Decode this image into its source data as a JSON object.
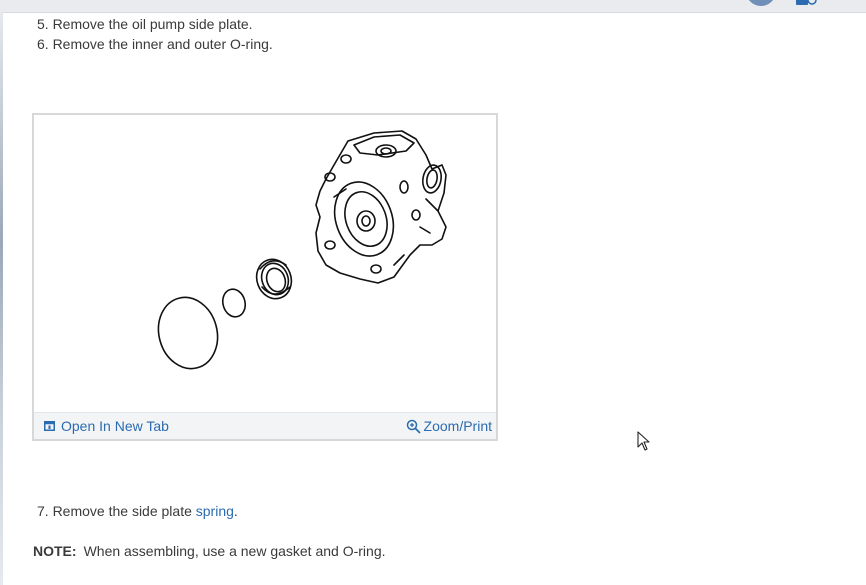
{
  "steps": [
    {
      "text": "5. Remove the oil pump side plate."
    },
    {
      "text": "6. Remove the inner and outer O-ring."
    },
    {
      "text_before": "7. Remove the side plate ",
      "link": "spring",
      "text_after": "."
    }
  ],
  "figure": {
    "open_tab_label": "Open In New Tab",
    "zoom_label": "Zoom/Print",
    "open_tab_icon": "open-new-tab-icon",
    "zoom_icon": "zoom-in-icon"
  },
  "note": {
    "label": "NOTE:",
    "text": "When assembling, use a new gasket and O-ring."
  },
  "colors": {
    "link": "#2b6cb0",
    "text": "#3a3a3a",
    "figure_border": "#d8d8d8"
  }
}
